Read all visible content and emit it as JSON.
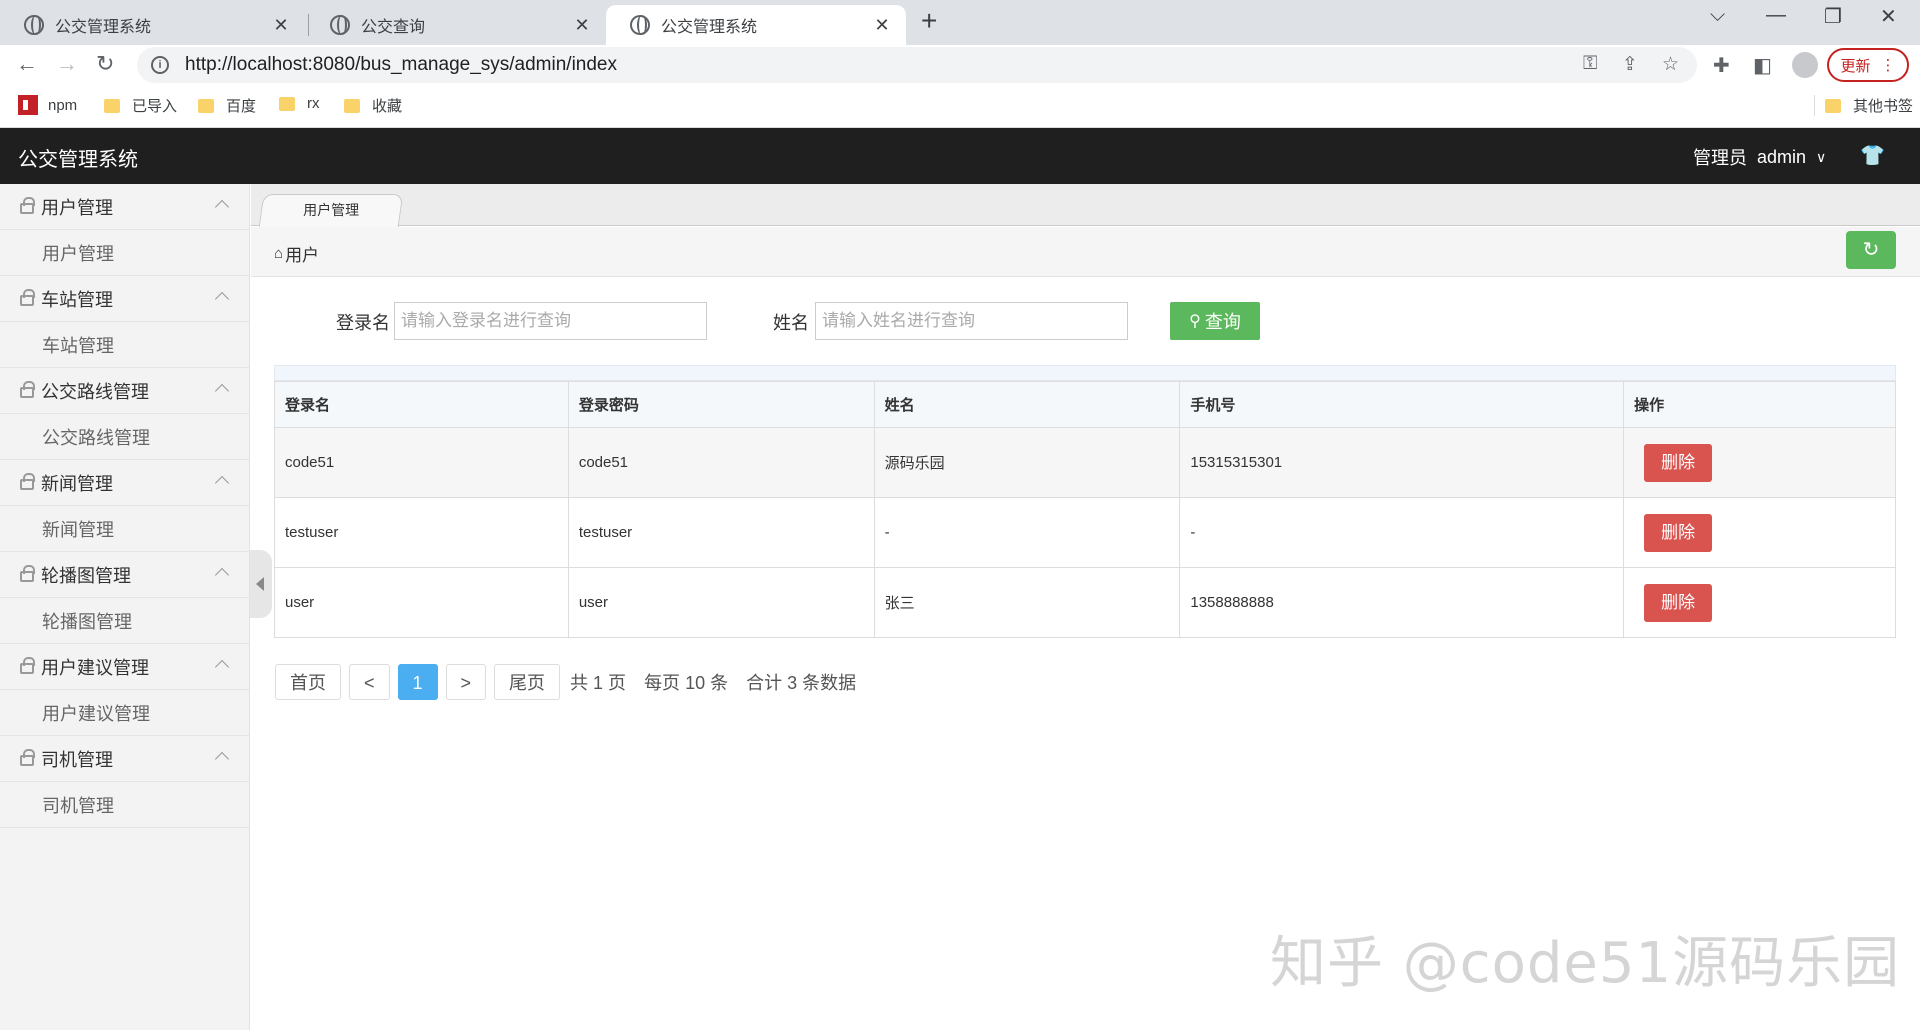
{
  "browser": {
    "tabs": [
      {
        "title": "公交管理系统"
      },
      {
        "title": "公交查询"
      },
      {
        "title": "公交管理系统"
      }
    ],
    "url": "http://localhost:8080/bus_manage_sys/admin/index",
    "update_label": "更新",
    "bookmarks": [
      "npm",
      "已导入",
      "百度",
      "rx",
      "收藏"
    ],
    "other_bookmarks": "其他书签"
  },
  "app": {
    "title": "公交管理系统",
    "role": "管理员",
    "username": "admin"
  },
  "sidebar": {
    "groups": [
      {
        "label": "用户管理",
        "item": "用户管理"
      },
      {
        "label": "车站管理",
        "item": "车站管理"
      },
      {
        "label": "公交路线管理",
        "item": "公交路线管理"
      },
      {
        "label": "新闻管理",
        "item": "新闻管理"
      },
      {
        "label": "轮播图管理",
        "item": "轮播图管理"
      },
      {
        "label": "用户建议管理",
        "item": "用户建议管理"
      },
      {
        "label": "司机管理",
        "item": "司机管理"
      }
    ]
  },
  "content": {
    "tab_label": "用户管理",
    "breadcrumb": "用户",
    "search": {
      "login_label": "登录名",
      "login_placeholder": "请输入登录名进行查询",
      "name_label": "姓名",
      "name_placeholder": "请输入姓名进行查询",
      "button": "查询"
    },
    "table": {
      "headers": [
        "登录名",
        "登录密码",
        "姓名",
        "手机号",
        "操作"
      ],
      "rows": [
        {
          "login": "code51",
          "password": "code51",
          "name": "源码乐园",
          "phone": "15315315301",
          "action": "删除"
        },
        {
          "login": "testuser",
          "password": "testuser",
          "name": "-",
          "phone": "-",
          "action": "删除"
        },
        {
          "login": "user",
          "password": "user",
          "name": "张三",
          "phone": "1358888888",
          "action": "删除"
        }
      ]
    },
    "pager": {
      "first": "首页",
      "prev": "<",
      "current": "1",
      "next": ">",
      "last": "尾页",
      "total_pages": "共 1 页",
      "per_page": "每页 10 条",
      "total": "合计 3 条数据"
    }
  },
  "watermark": "知乎 @code51源码乐园"
}
